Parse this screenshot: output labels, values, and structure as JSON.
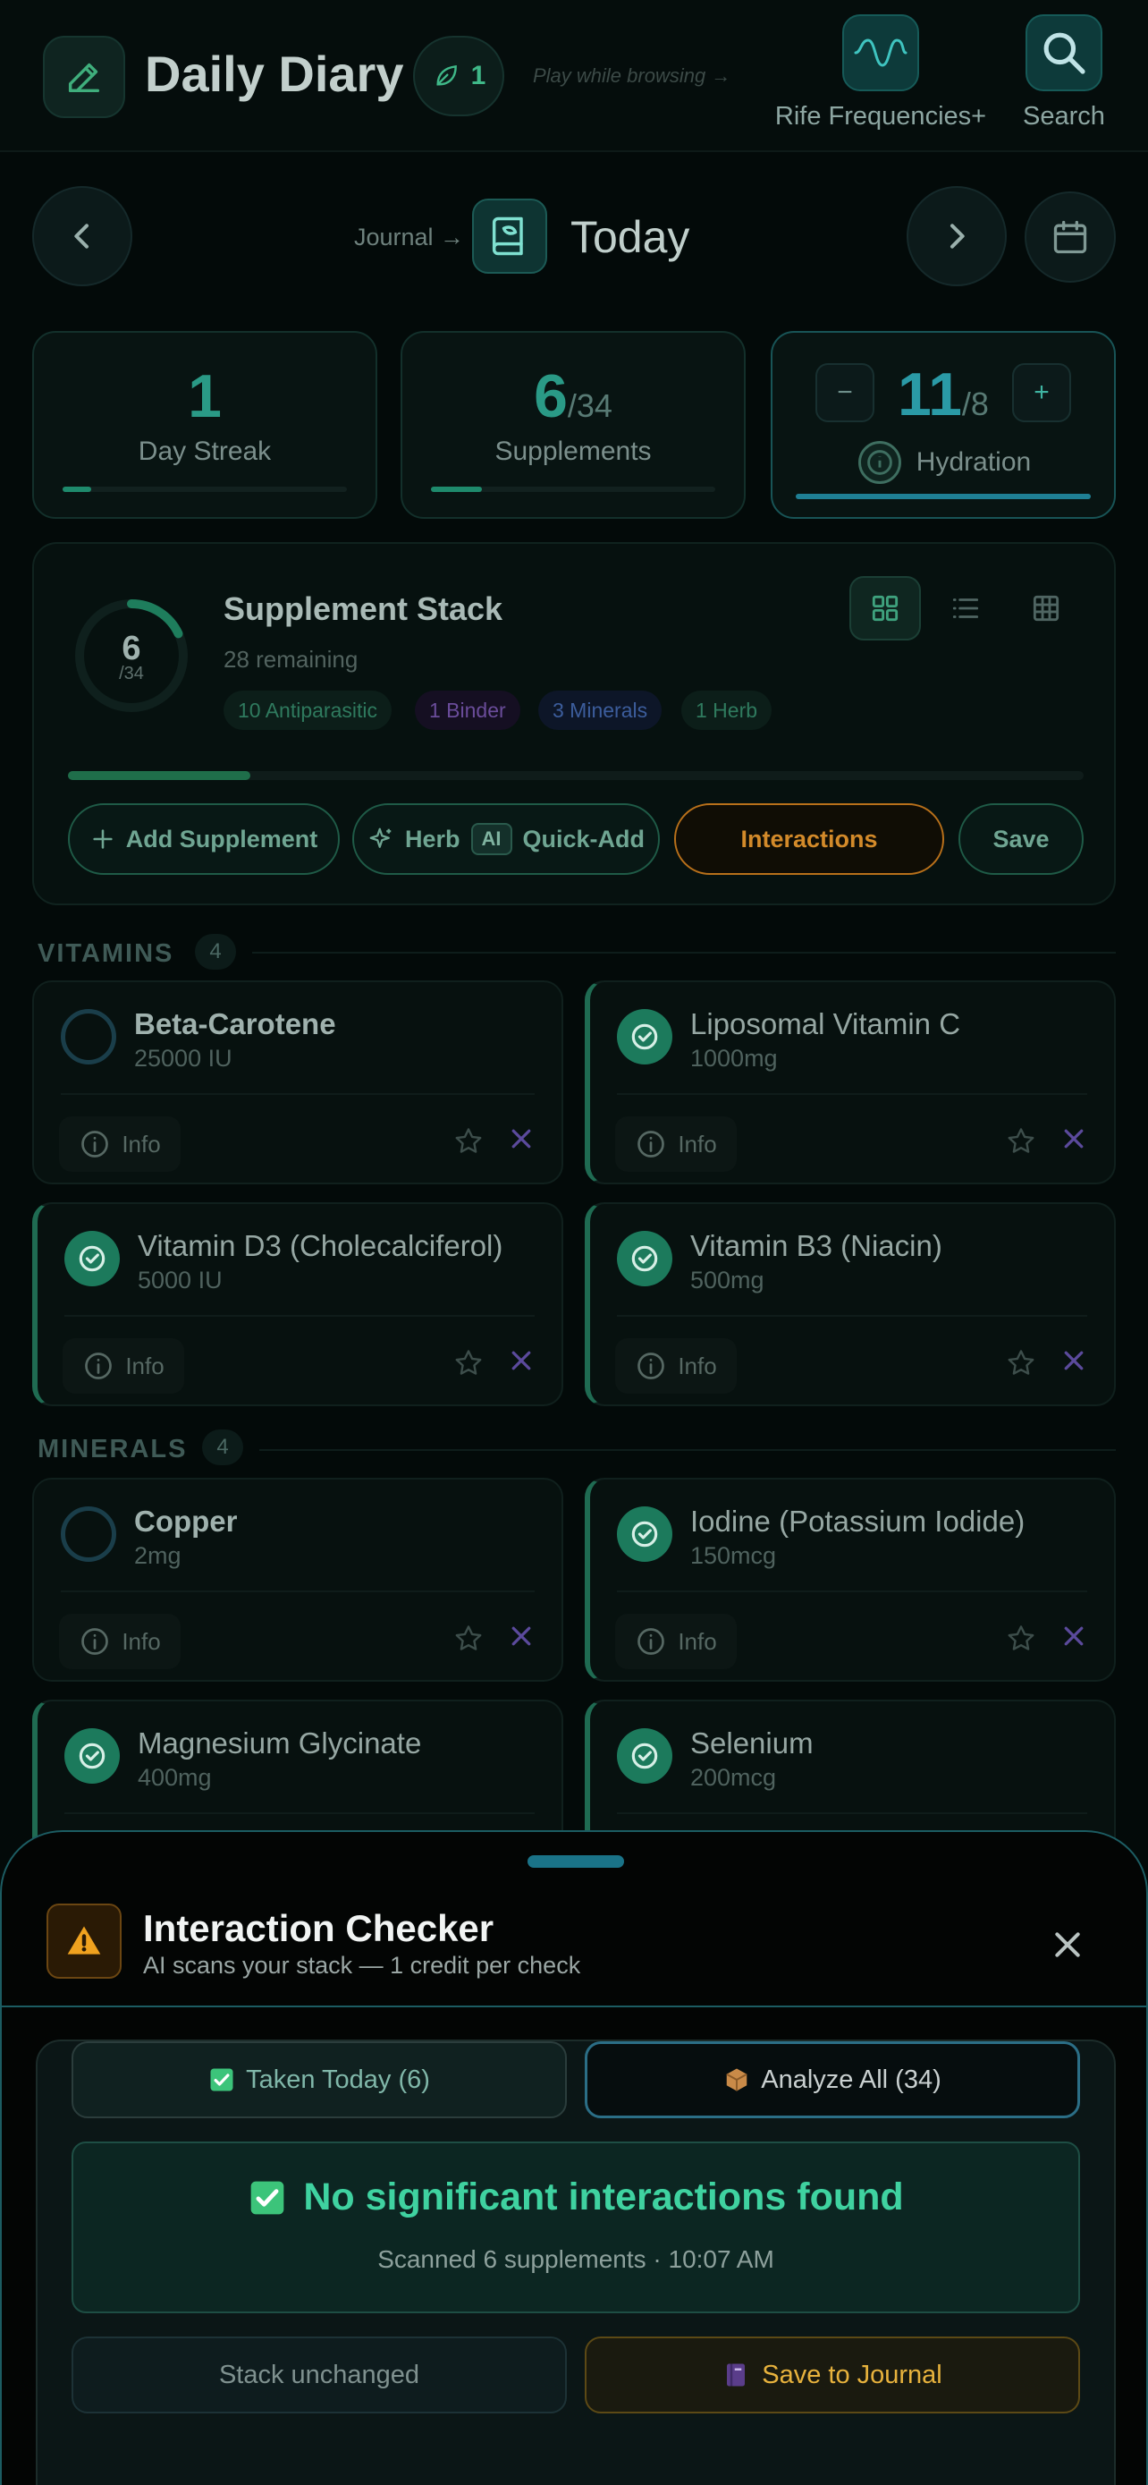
{
  "header": {
    "title": "Daily Diary",
    "leaf_count": "1",
    "play_hint": "Play while browsing →",
    "rife_label": "Rife Frequencies+",
    "search_label": "Search"
  },
  "daynav": {
    "journal_label": "Journal →",
    "day_label": "Today"
  },
  "stats": {
    "streak": {
      "value": "1",
      "label": "Day Streak",
      "progress": 0.1
    },
    "supplements": {
      "value": "6",
      "total": "/34",
      "label": "Supplements",
      "progress": 0.18
    },
    "hydration": {
      "value": "11",
      "total": "/8",
      "label": "Hydration",
      "progress": 1.0,
      "minus": "−",
      "plus": "+"
    }
  },
  "stack": {
    "ring_value": "6",
    "ring_total": "/34",
    "ring_progress": 0.18,
    "title": "Supplement Stack",
    "remaining": "28 remaining",
    "tags": [
      {
        "label": "10 Antiparasitic",
        "color": "#2f7a5e",
        "bg": "#0c1e19"
      },
      {
        "label": "1 Binder",
        "color": "#6a4c9a",
        "bg": "#150f22"
      },
      {
        "label": "3 Minerals",
        "color": "#3c5d9c",
        "bg": "#0d1628"
      },
      {
        "label": "1 Herb",
        "color": "#2f7a5e",
        "bg": "#0c1e19"
      }
    ],
    "progress": 0.18,
    "add_label": "Add Supplement",
    "herb_label": "Herb",
    "ai_label": "AI",
    "quickadd_label": "Quick-Add",
    "interactions_label": "Interactions",
    "save_label": "Save"
  },
  "sections": {
    "vitamins": {
      "label": "VITAMINS",
      "count": "4"
    },
    "minerals": {
      "label": "MINERALS",
      "count": "4"
    }
  },
  "cards": [
    {
      "name": "Beta-Carotene",
      "dose": "25000 IU",
      "taken": false
    },
    {
      "name": "Liposomal Vitamin C",
      "dose": "1000mg",
      "taken": true
    },
    {
      "name": "Vitamin D3 (Cholecalciferol)",
      "dose": "5000 IU",
      "taken": true
    },
    {
      "name": "Vitamin B3 (Niacin)",
      "dose": "500mg",
      "taken": true
    },
    {
      "name": "Copper",
      "dose": "2mg",
      "taken": false
    },
    {
      "name": "Iodine (Potassium Iodide)",
      "dose": "150mcg",
      "taken": true
    },
    {
      "name": "Magnesium Glycinate",
      "dose": "400mg",
      "taken": true
    },
    {
      "name": "Selenium",
      "dose": "200mcg",
      "taken": true
    }
  ],
  "info_label": "Info",
  "sheet": {
    "title": "Interaction Checker",
    "subtitle": "AI scans your stack — 1 credit per check",
    "tab_taken": "Taken Today (6)",
    "tab_all": "Analyze All (34)",
    "result_title": "No significant interactions found",
    "result_sub": "Scanned 6 supplements · 10:07 AM",
    "stack_unchanged": "Stack unchanged",
    "save_journal": "Save to Journal"
  },
  "colors": {
    "accent": "#1f8a6c",
    "success": "#3fd2a0",
    "warning": "#e7b23d",
    "sheet_border": "#1c5c62"
  },
  "icons": [
    "pencil-icon",
    "leaf-icon",
    "wave-icon",
    "search-icon",
    "chevron-left-icon",
    "chevron-right-icon",
    "calendar-icon",
    "book-icon",
    "info-icon",
    "star-icon",
    "close-icon",
    "check-icon",
    "grid-icon",
    "list-icon",
    "table-icon",
    "plus-icon",
    "sparkle-icon",
    "warning-icon",
    "package-icon",
    "notebook-icon"
  ]
}
